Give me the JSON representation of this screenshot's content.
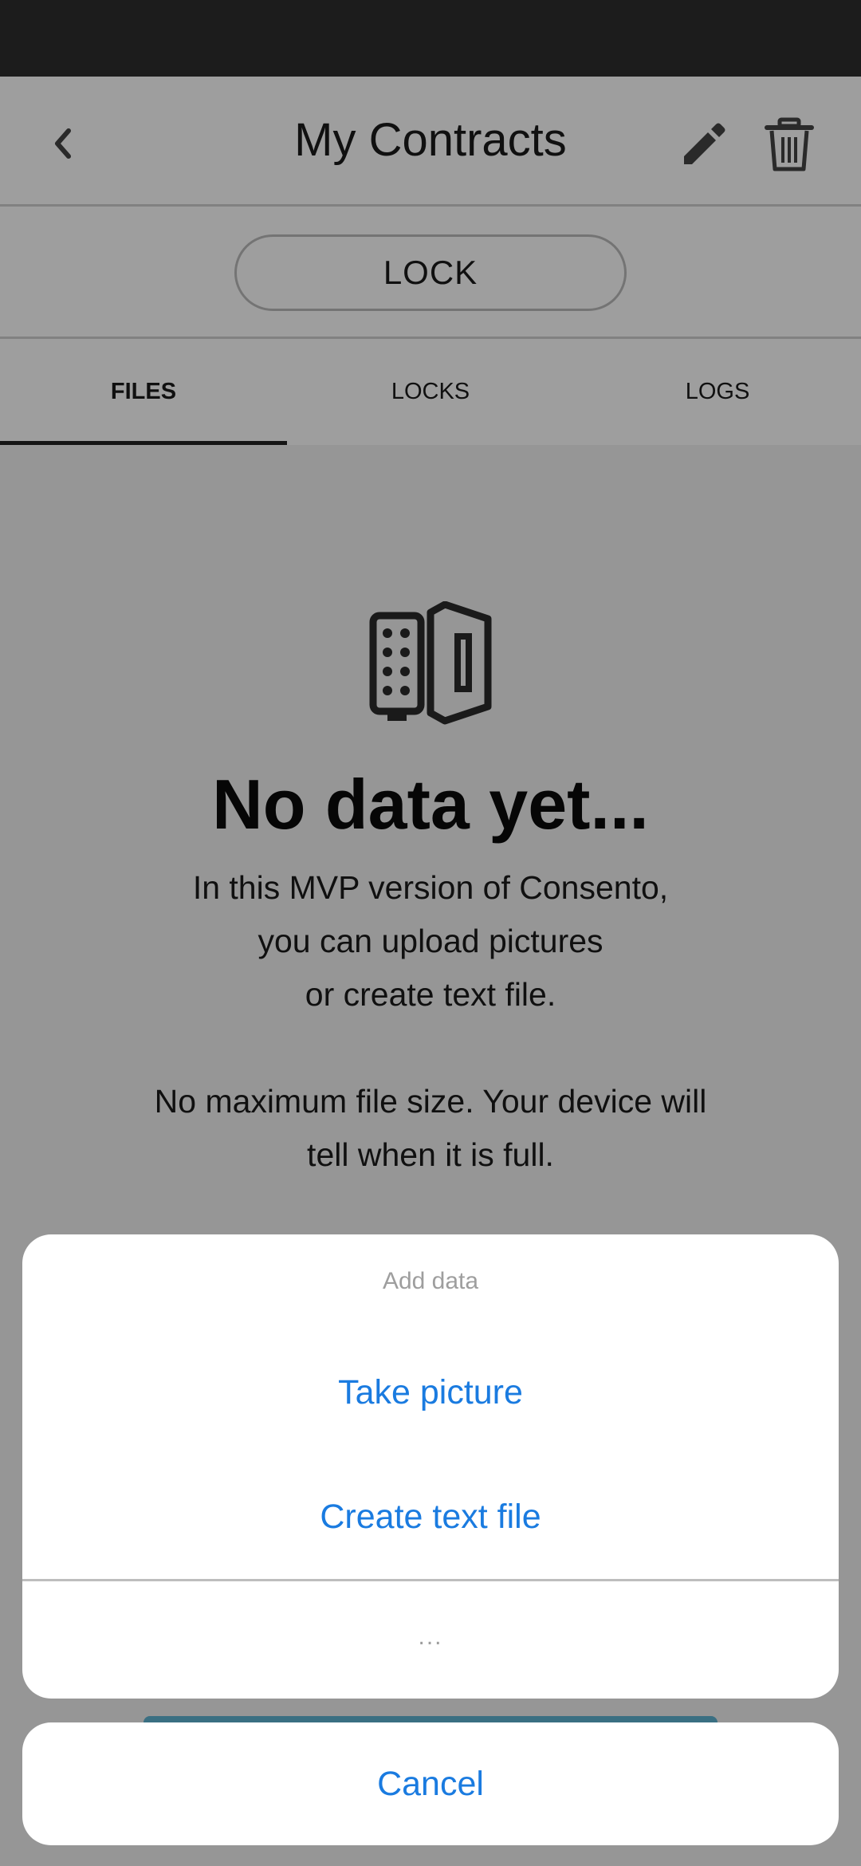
{
  "header": {
    "title": "My Contracts"
  },
  "icons": {
    "back": "chevron-left-icon",
    "edit": "pencil-icon",
    "delete": "trash-icon",
    "empty_state": "locker-icon"
  },
  "lock_button": {
    "label": "LOCK"
  },
  "tabs": [
    {
      "label": "FILES",
      "active": true
    },
    {
      "label": "LOCKS",
      "active": false
    },
    {
      "label": "LOGS",
      "active": false
    }
  ],
  "empty_state": {
    "title": "No data yet...",
    "text1": "In this MVP version of Consento,\nyou can upload pictures\nor create text file.",
    "text2": "No maximum file size. Your device will\ntell when it is full."
  },
  "action_sheet": {
    "title": "Add data",
    "actions": [
      "Take picture",
      "Create text file"
    ],
    "more": "...",
    "cancel": "Cancel"
  },
  "colors": {
    "accent": "#1a7be0",
    "status_bar": "#2e2e2e",
    "scrim": "rgba(0,0,0,0.38)"
  }
}
